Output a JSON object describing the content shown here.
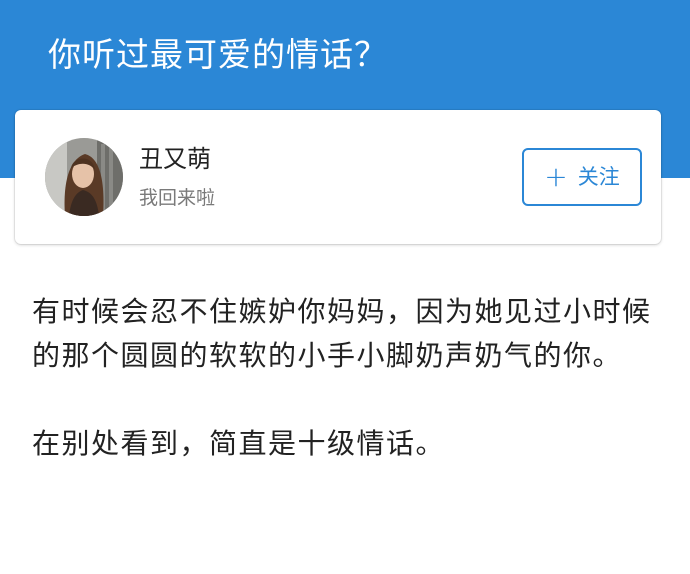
{
  "question": {
    "title": "你听过最可爱的情话？"
  },
  "author": {
    "name": "丑又萌",
    "bio": "我回来啦",
    "avatar": "avatar-photo"
  },
  "follow_button": {
    "icon": "plus-icon",
    "plus_glyph": "+",
    "label": "关注"
  },
  "answer": {
    "paragraphs": [
      "有时候会忍不住嫉妒你妈妈，因为她见过小时候的那个圆圆的软软的小手小脚奶声奶气的你。",
      "在别处看到，简直是十级情话。"
    ]
  },
  "colors": {
    "brand_blue": "#2b87d6",
    "text_primary": "#222222",
    "text_secondary": "#7a7a7a"
  }
}
